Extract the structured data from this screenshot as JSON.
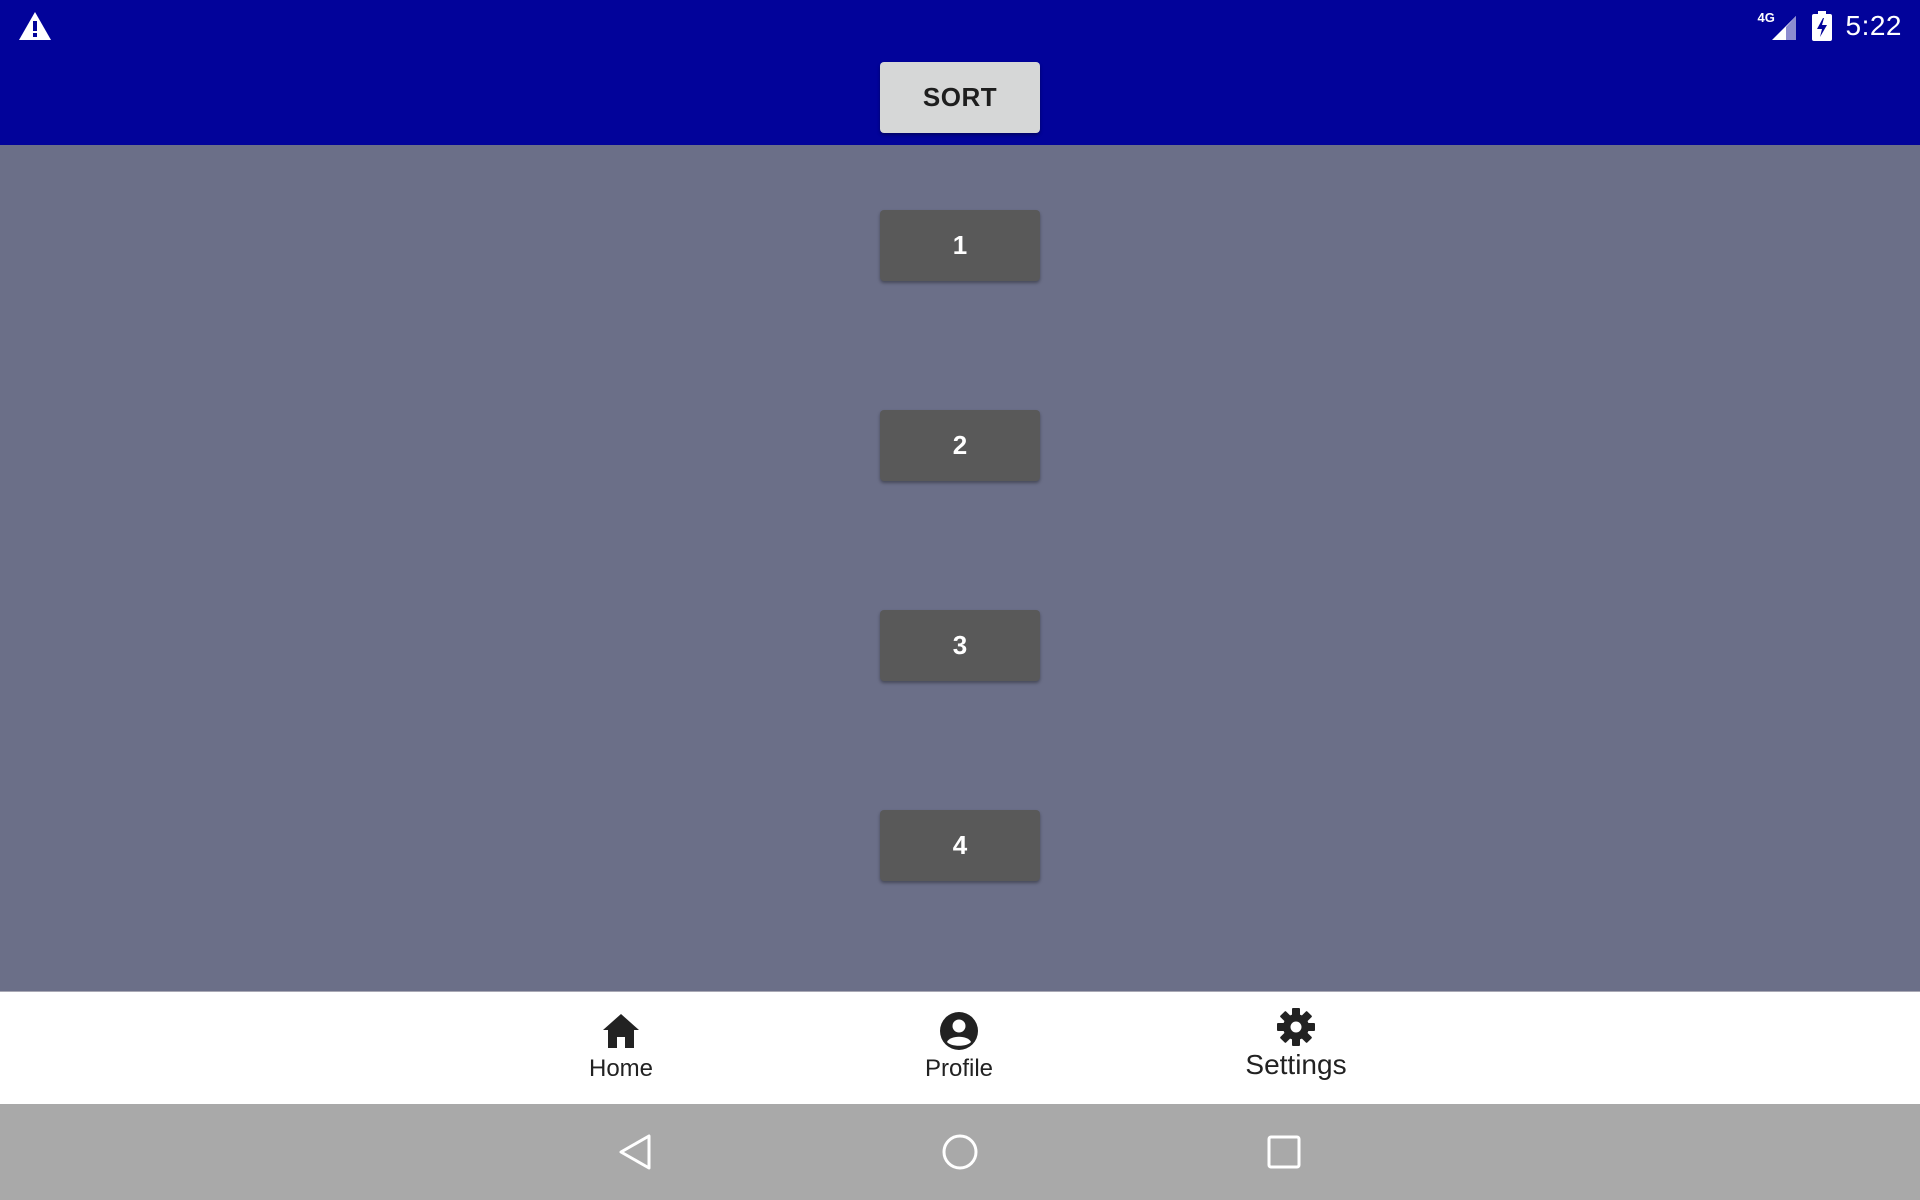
{
  "status_bar": {
    "network": "4G",
    "time": "5:22",
    "icons": [
      "warning-icon",
      "signal-icon",
      "battery-charging-icon"
    ]
  },
  "toolbar": {
    "sort_label": "SORT"
  },
  "items": [
    "1",
    "2",
    "3",
    "4"
  ],
  "bottom_nav": {
    "home_label": "Home",
    "profile_label": "Profile",
    "settings_label": "Settings"
  },
  "system_nav": {
    "icons": [
      "back-icon",
      "home-circle-icon",
      "recents-icon"
    ]
  },
  "colors": {
    "top_bar": "#02039a",
    "content_bg": "#6b6f88",
    "item_button": "#595959",
    "sort_button": "#d6d7d7",
    "bottom_nav_bg": "#ffffff",
    "system_nav_bg": "#a9a9a9"
  }
}
